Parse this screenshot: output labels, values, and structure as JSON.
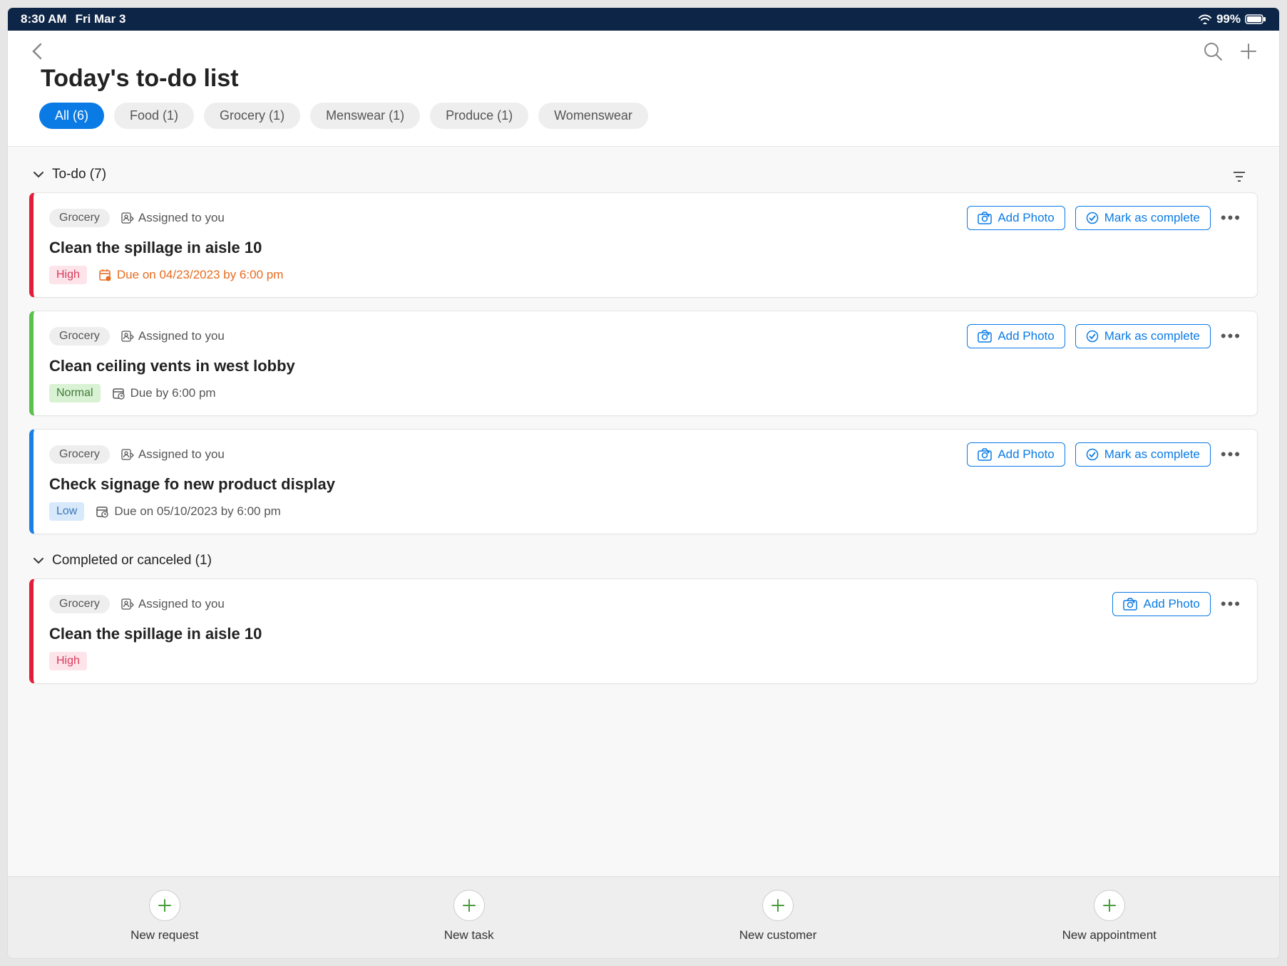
{
  "status_bar": {
    "time": "8:30 AM",
    "date": "Fri Mar 3",
    "battery": "99%"
  },
  "page_title": "Today's to-do list",
  "filters": [
    {
      "label": "All (6)",
      "active": true
    },
    {
      "label": "Food (1)"
    },
    {
      "label": "Grocery (1)"
    },
    {
      "label": "Menswear (1)"
    },
    {
      "label": "Produce (1)"
    },
    {
      "label": "Womenswear"
    }
  ],
  "sections": {
    "todo_label": "To-do (7)",
    "completed_label": "Completed or canceled (1)"
  },
  "actions": {
    "add_photo": "Add Photo",
    "mark_complete": "Mark as complete"
  },
  "tasks": [
    {
      "tag": "Grocery",
      "assigned": "Assigned to you",
      "title": "Clean the spillage in aisle 10",
      "priority": "High",
      "pclass": "p-high",
      "due": "Due on 04/23/2023 by 6:00 pm",
      "due_class": "due-overdue",
      "border": "bl-red"
    },
    {
      "tag": "Grocery",
      "assigned": "Assigned to you",
      "title": "Clean ceiling vents in west lobby",
      "priority": "Normal",
      "pclass": "p-normal",
      "due": "Due by 6:00 pm",
      "due_class": "due-normal",
      "border": "bl-green"
    },
    {
      "tag": "Grocery",
      "assigned": "Assigned to you",
      "title": "Check signage fo new product display",
      "priority": "Low",
      "pclass": "p-low",
      "due": "Due on 05/10/2023 by 6:00 pm",
      "due_class": "due-normal",
      "border": "bl-blue"
    }
  ],
  "completed": [
    {
      "tag": "Grocery",
      "assigned": "Assigned to you",
      "title": "Clean the spillage in aisle 10",
      "priority": "High",
      "pclass": "p-high",
      "border": "bl-red2"
    }
  ],
  "bottom_actions": [
    {
      "label": "New request"
    },
    {
      "label": "New task"
    },
    {
      "label": "New customer"
    },
    {
      "label": "New appointment"
    }
  ]
}
